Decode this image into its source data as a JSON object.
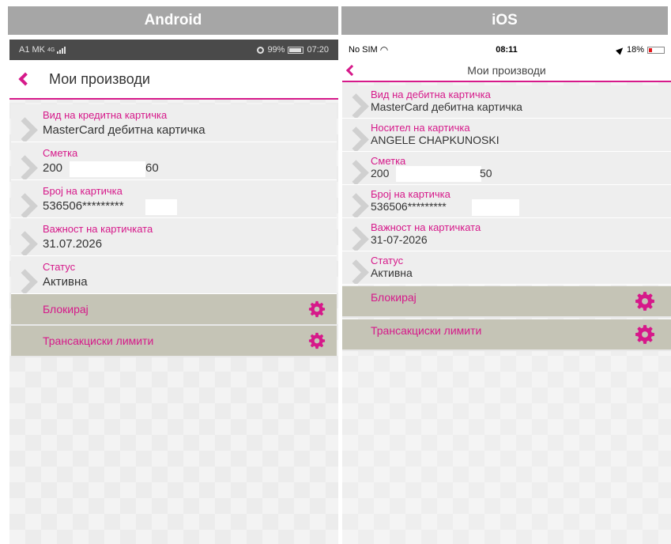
{
  "headers": {
    "android": "Android",
    "ios": "iOS"
  },
  "colors": {
    "accent": "#d6198a",
    "action_bg": "#c5c4b6",
    "row_bg": "#eeeeee",
    "header_bg": "#a6a6a6"
  },
  "android": {
    "status": {
      "carrier": "A1 MK",
      "network": "4G",
      "battery": "99%",
      "time": "07:20"
    },
    "nav_title": "Мои производи",
    "rows": [
      {
        "label": "Вид на кредитна картичка",
        "value": "MasterCard дебитна картичка"
      },
      {
        "label": "Сметка",
        "value_start": "200",
        "value_end": "60"
      },
      {
        "label": "Број на картичка",
        "value": "536506*********"
      },
      {
        "label": "Важност на картичката",
        "value": "31.07.2026"
      },
      {
        "label": "Статус",
        "value": "Активна"
      }
    ],
    "actions": [
      {
        "label": "Блокирај",
        "icon": "gear-icon"
      },
      {
        "label": "Трансакциски лимити",
        "icon": "gear-icon"
      }
    ]
  },
  "ios": {
    "status": {
      "carrier": "No SIM",
      "time": "08:11",
      "battery": "18%"
    },
    "nav_title": "Мои производи",
    "rows": [
      {
        "label": "Вид на дебитна картичка",
        "value": "MasterCard дебитна картичка"
      },
      {
        "label": "Носител на картичка",
        "value": "ANGELE CHAPKUNOSKI"
      },
      {
        "label": "Сметка",
        "value_start": "200",
        "value_end": "50"
      },
      {
        "label": "Број на картичка",
        "value": "536506*********"
      },
      {
        "label": "Важност на картичката",
        "value": "31-07-2026"
      },
      {
        "label": "Статус",
        "value": "Активна"
      }
    ],
    "actions": [
      {
        "label": "Блокирај",
        "icon": "gear-icon"
      },
      {
        "label": "Трансакциски лимити",
        "icon": "gear-icon"
      }
    ]
  }
}
